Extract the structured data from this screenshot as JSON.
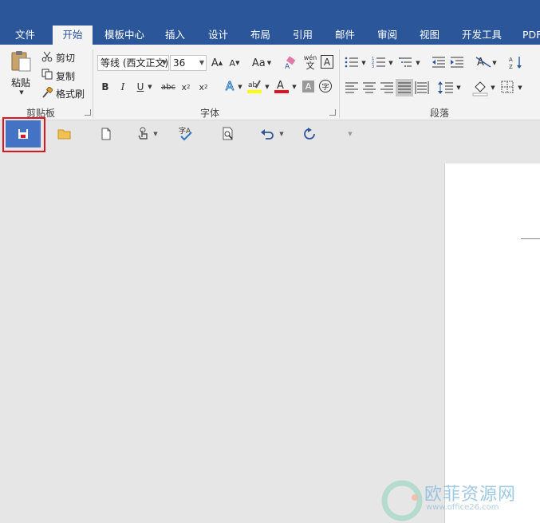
{
  "tabs": [
    {
      "label": "文件"
    },
    {
      "label": "开始"
    },
    {
      "label": "模板中心"
    },
    {
      "label": "插入"
    },
    {
      "label": "设计"
    },
    {
      "label": "布局"
    },
    {
      "label": "引用"
    },
    {
      "label": "邮件"
    },
    {
      "label": "审阅"
    },
    {
      "label": "视图"
    },
    {
      "label": "开发工具"
    },
    {
      "label": "PDF"
    }
  ],
  "clipboard": {
    "group_label": "剪贴板",
    "paste": "粘贴",
    "cut": "剪切",
    "copy": "复制",
    "format_painter": "格式刷"
  },
  "font": {
    "group_label": "字体",
    "font_name": "等线 (西文正文)",
    "font_size": "36",
    "change_case": "Aa",
    "phonetic": "wén",
    "phonetic_char": "文",
    "border_char": "A",
    "enclose_char": "字"
  },
  "paragraph": {
    "group_label": "段落"
  },
  "watermark": {
    "brand": "欧菲资源网",
    "url": "www.office26.com"
  },
  "colors": {
    "accent": "#2b579a",
    "highlight": "#ffff00",
    "font_color": "#e0141e",
    "selection_box": "#e0141e",
    "save_bg": "#4472c4"
  }
}
